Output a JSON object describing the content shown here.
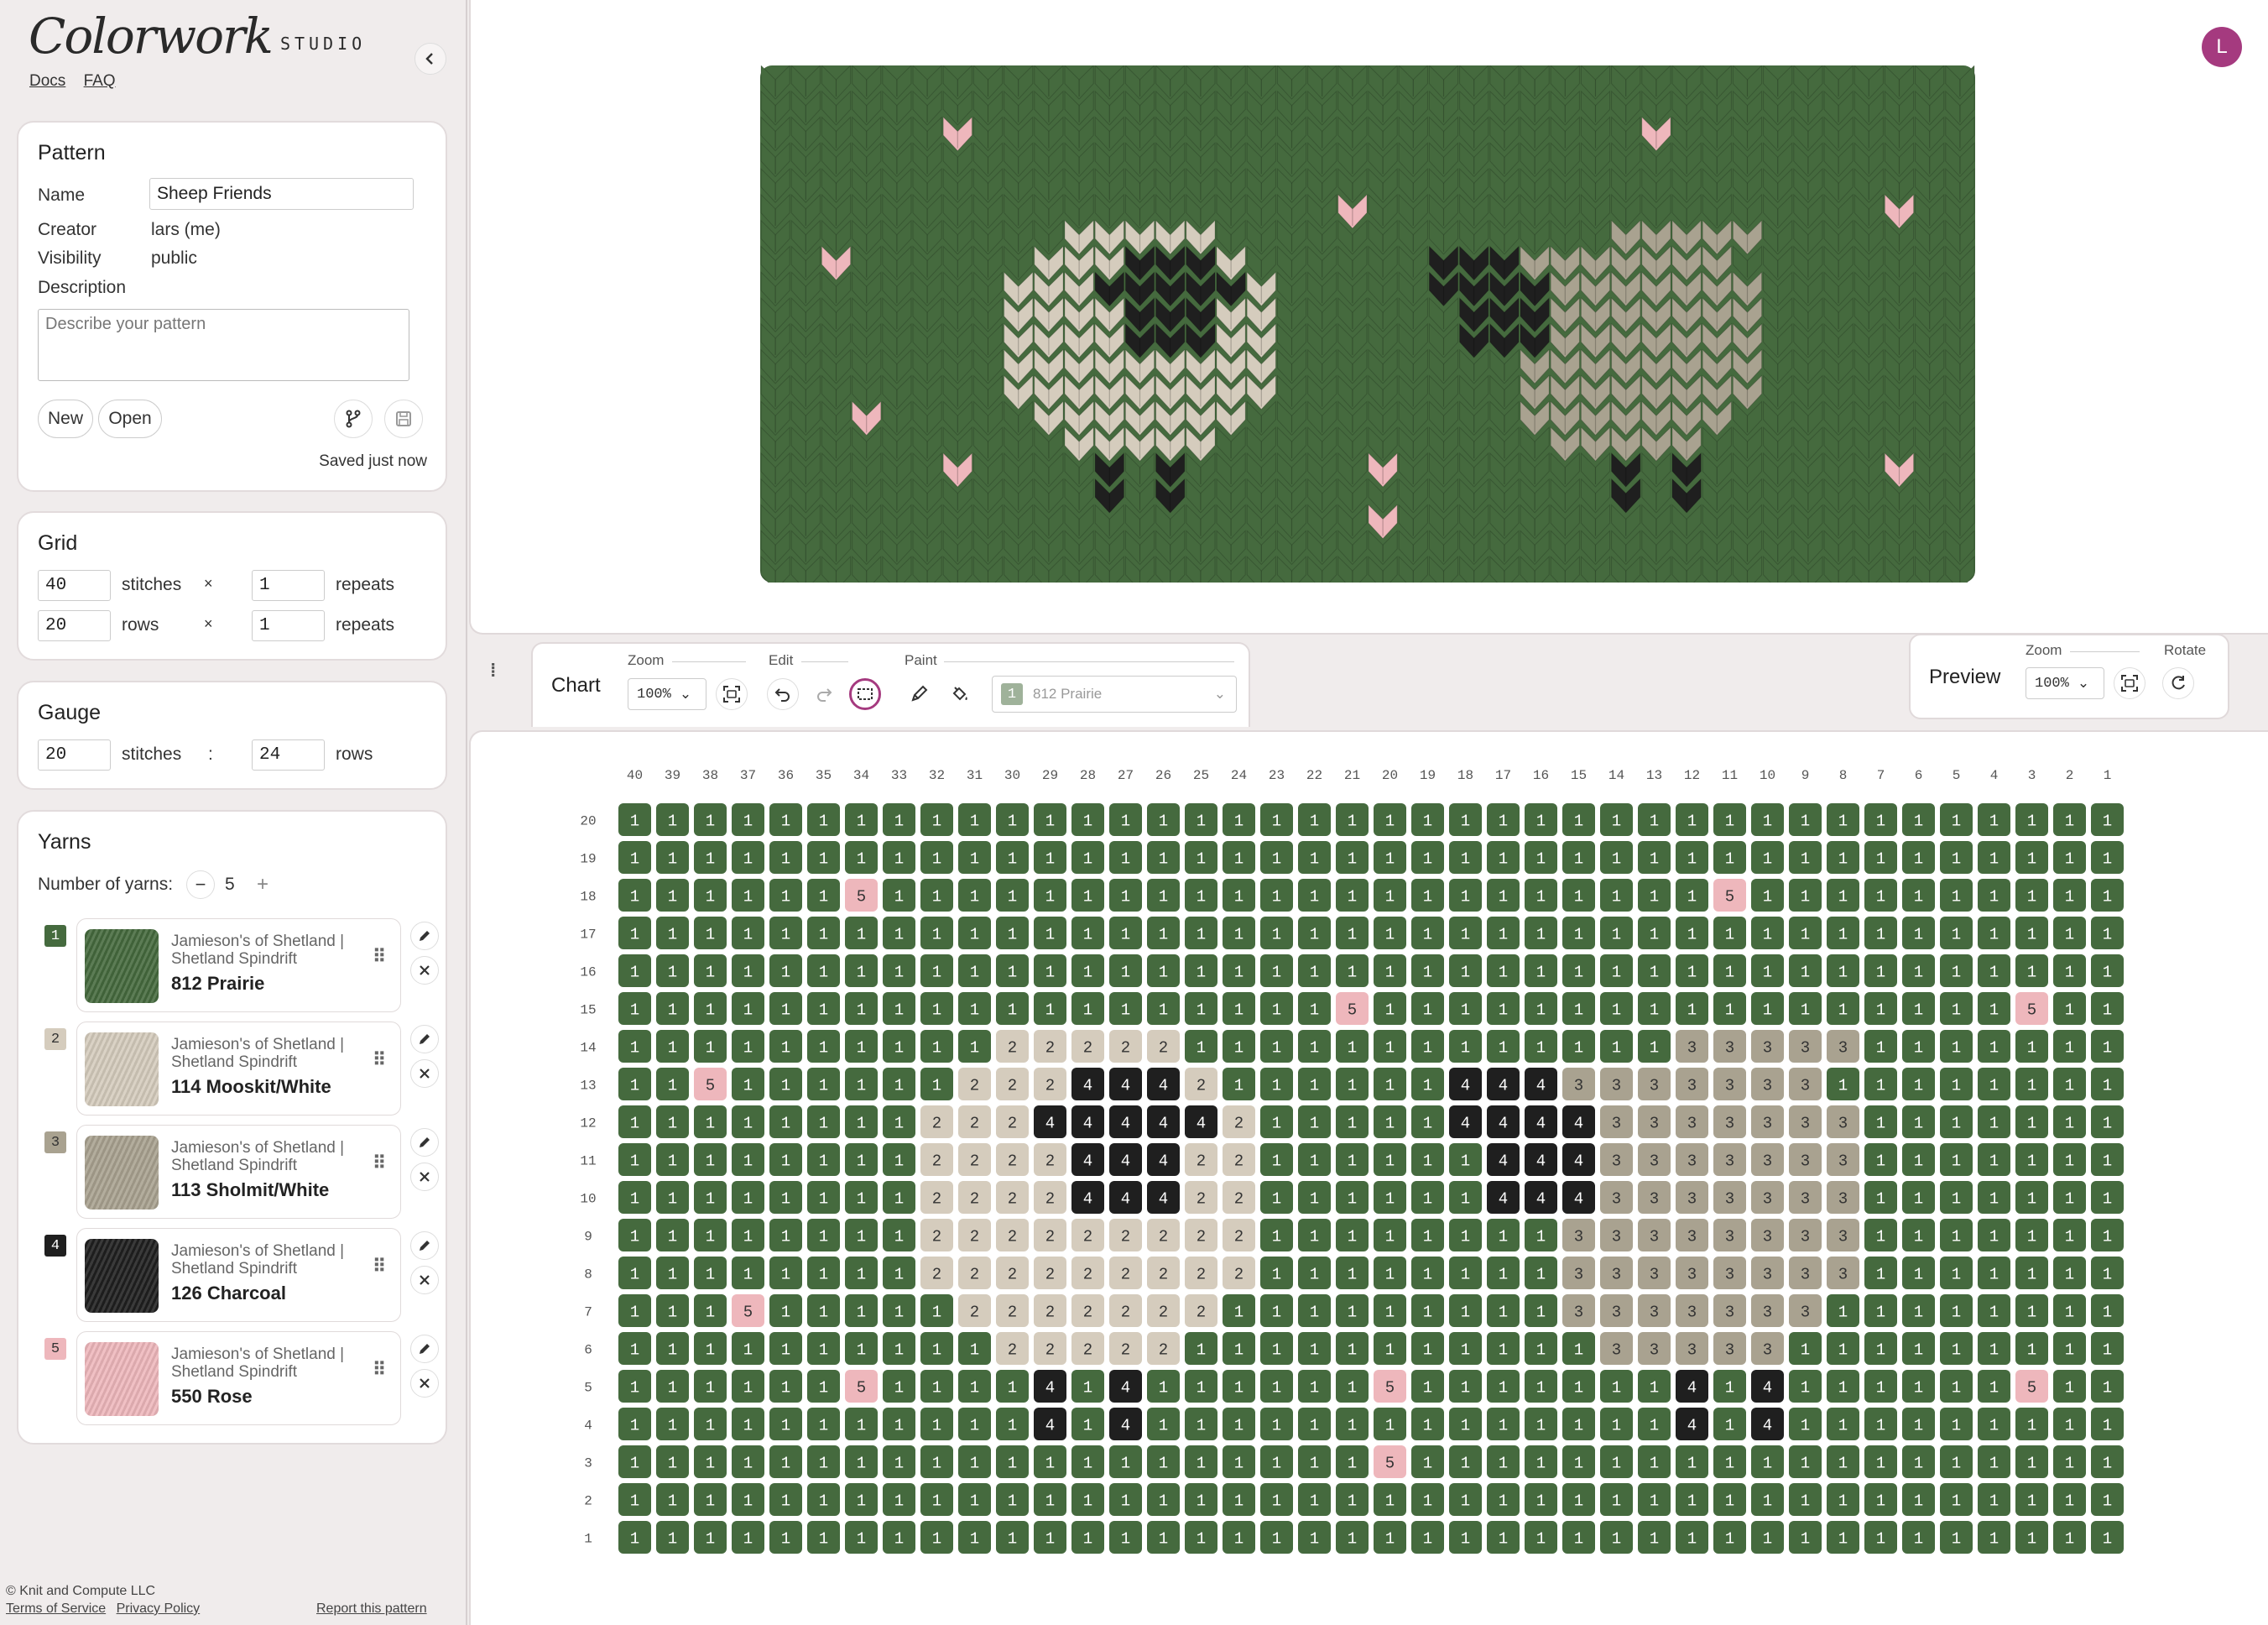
{
  "app": {
    "brand_script": "Colorwork",
    "brand_studio": "STUDIO",
    "links": [
      "Docs",
      "FAQ"
    ],
    "avatar_letter": "L"
  },
  "pattern": {
    "title": "Pattern",
    "name_label": "Name",
    "name_value": "Sheep Friends",
    "creator_label": "Creator",
    "creator_value": "lars (me)",
    "visibility_label": "Visibility",
    "visibility_value": "public",
    "description_label": "Description",
    "description_placeholder": "Describe your pattern",
    "new_label": "New",
    "open_label": "Open",
    "saved_status": "Saved just now"
  },
  "grid": {
    "title": "Grid",
    "stitches": "40",
    "stitches_label": "stitches",
    "stitch_repeats": "1",
    "rows": "20",
    "rows_label": "rows",
    "row_repeats": "1",
    "times": "×",
    "repeats_label": "repeats"
  },
  "gauge": {
    "title": "Gauge",
    "stitches": "20",
    "stitches_label": "stitches",
    "sep": ":",
    "rows": "24",
    "rows_label": "rows"
  },
  "yarns": {
    "title": "Yarns",
    "count_label": "Number of yarns:",
    "count": "5",
    "minus": "−",
    "plus": "+",
    "items": [
      {
        "num": "1",
        "brand": "Jamieson's of Shetland | Shetland Spindrift",
        "name": "812 Prairie",
        "color": "#456a3e",
        "text_color": "#ffffff"
      },
      {
        "num": "2",
        "brand": "Jamieson's of Shetland | Shetland Spindrift",
        "name": "114 Mooskit/White",
        "color": "#d5ccbd",
        "text_color": "#333333"
      },
      {
        "num": "3",
        "brand": "Jamieson's of Shetland | Shetland Spindrift",
        "name": "113 Sholmit/White",
        "color": "#a9a290",
        "text_color": "#333333"
      },
      {
        "num": "4",
        "brand": "Jamieson's of Shetland | Shetland Spindrift",
        "name": "126 Charcoal",
        "color": "#1f1f1f",
        "text_color": "#ffffff"
      },
      {
        "num": "5",
        "brand": "Jamieson's of Shetland | Shetland Spindrift",
        "name": "550 Rose",
        "color": "#eeb7bc",
        "text_color": "#333333"
      }
    ]
  },
  "footer": {
    "copyright": "© Knit and Compute LLC",
    "terms": "Terms of Service",
    "privacy": "Privacy Policy",
    "report": "Report this pattern"
  },
  "chart_toolbar": {
    "title": "Chart",
    "zoom_label": "Zoom",
    "zoom_value": "100%",
    "edit_label": "Edit",
    "paint_label": "Paint",
    "paint_yarn_num": "1",
    "paint_yarn_name": "812 Prairie"
  },
  "preview_toolbar": {
    "title": "Preview",
    "zoom_label": "Zoom",
    "zoom_value": "100%",
    "rotate_label": "Rotate"
  },
  "chart": {
    "columns": [
      "40",
      "39",
      "38",
      "37",
      "36",
      "35",
      "34",
      "33",
      "32",
      "31",
      "30",
      "29",
      "28",
      "27",
      "26",
      "25",
      "24",
      "23",
      "22",
      "21",
      "20",
      "19",
      "18",
      "17",
      "16",
      "15",
      "14",
      "13",
      "12",
      "11",
      "10",
      "9",
      "8",
      "7",
      "6",
      "5",
      "4",
      "3",
      "2",
      "1"
    ],
    "rows": [
      {
        "label": "20",
        "cells": "1111111111111111111111111111111111111111"
      },
      {
        "label": "19",
        "cells": "1111111111111111111111111111111111111111"
      },
      {
        "label": "18",
        "cells": "1111115111111111111111111111151111111111"
      },
      {
        "label": "17",
        "cells": "1111111111111111111111111111111111111111"
      },
      {
        "label": "16",
        "cells": "1111111111111111111111111111111111111111"
      },
      {
        "label": "15",
        "cells": "1111111111111111111511111111111111111511"
      },
      {
        "label": "14",
        "cells": "1111111111222221111111111111333331111111"
      },
      {
        "label": "13",
        "cells": "1151111112224442111111444333333311111111"
      },
      {
        "label": "12",
        "cells": "1111111122244444211111444433333331111111"
      },
      {
        "label": "11",
        "cells": "1111111122224442211111144433333331111111"
      },
      {
        "label": "10",
        "cells": "1111111122224442211111144433333331111111"
      },
      {
        "label": "9",
        "cells": "1111111122222222211111111333333331111111"
      },
      {
        "label": "8",
        "cells": "1111111122222222211111111333333331111111"
      },
      {
        "label": "7",
        "cells": "1115111112222222111111111333333311111111"
      },
      {
        "label": "6",
        "cells": "1111111111222221111111111133333111111111"
      },
      {
        "label": "5",
        "cells": "1111115111141411111151111111414111111511"
      },
      {
        "label": "4",
        "cells": "1111111111141411111111111111414111111111"
      },
      {
        "label": "3",
        "cells": "1111111111111111111151111111111111111111"
      },
      {
        "label": "2",
        "cells": "1111111111111111111111111111111111111111"
      },
      {
        "label": "1",
        "cells": "1111111111111111111111111111111111111111"
      }
    ]
  }
}
